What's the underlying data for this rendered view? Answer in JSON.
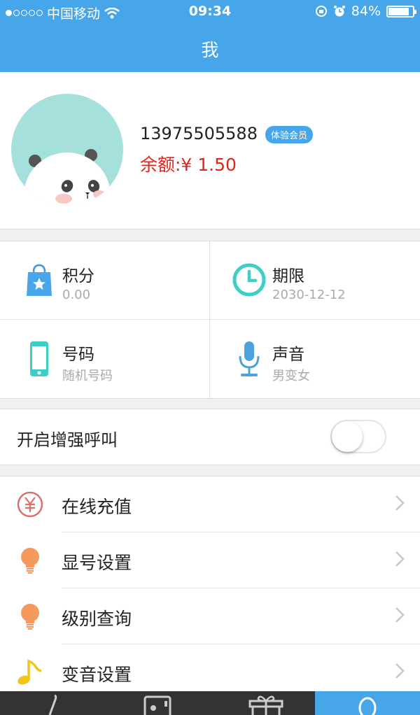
{
  "status_bar": {
    "carrier": "中国移动",
    "time": "09:34",
    "battery_text": "84%",
    "battery_level": 0.84
  },
  "nav": {
    "title": "我"
  },
  "profile": {
    "phone": "13975505588",
    "badge": "体验会员",
    "balance": "余额:¥ 1.50"
  },
  "stats": [
    {
      "label": "积分",
      "value": "0.00",
      "icon": "shopping-bag-star-icon"
    },
    {
      "label": "期限",
      "value": "2030-12-12",
      "icon": "clock-icon"
    },
    {
      "label": "号码",
      "value": "随机号码",
      "icon": "phone-icon"
    },
    {
      "label": "声音",
      "value": "男变女",
      "icon": "microphone-icon"
    }
  ],
  "enhanced_call": {
    "label": "开启增强呼叫",
    "enabled": false
  },
  "menu": [
    {
      "label": "在线充值",
      "icon": "yen-icon"
    },
    {
      "label": "显号设置",
      "icon": "lightbulb-icon"
    },
    {
      "label": "级别查询",
      "icon": "lightbulb-icon"
    },
    {
      "label": "变音设置",
      "icon": "music-note-icon"
    }
  ],
  "tabs": [
    {
      "icon": "phone-handset-icon",
      "active": false
    },
    {
      "icon": "contacts-icon",
      "active": false
    },
    {
      "icon": "gift-icon",
      "active": false
    },
    {
      "icon": "user-icon",
      "active": true
    }
  ],
  "colors": {
    "primary": "#47a6ea",
    "balance": "#e8211d",
    "bulb": "#f39a5c",
    "note": "#f0c419",
    "teal": "#3dcec6",
    "mic": "#4aa3df"
  }
}
